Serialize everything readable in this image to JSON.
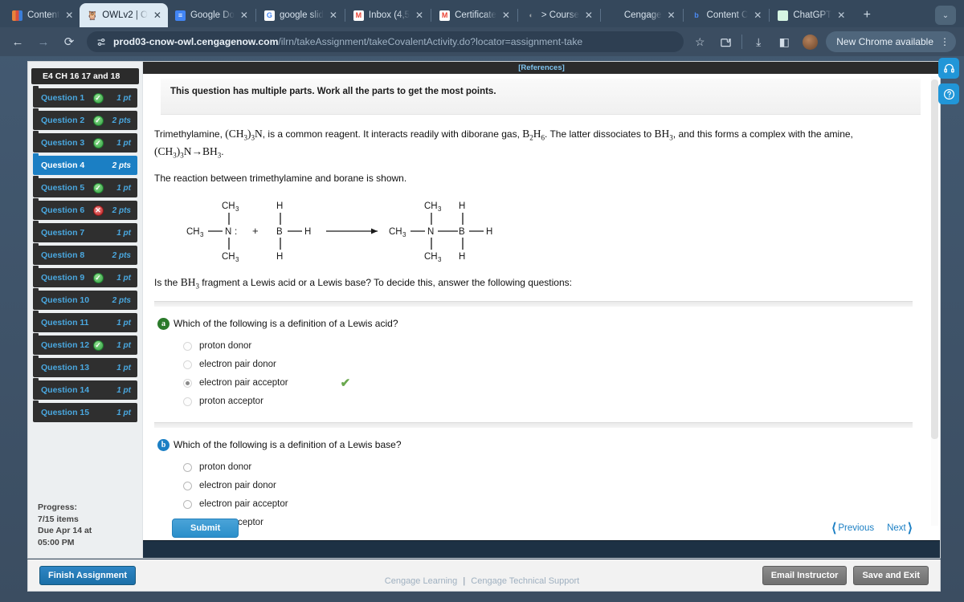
{
  "browser": {
    "tabs": [
      {
        "title": "Content",
        "favicon": "chart-bar-icon",
        "favicon_color": "#e8833a",
        "active": false
      },
      {
        "title": "OWLv2 | O",
        "favicon": "owl-icon",
        "favicon_color": "#8ec9ea",
        "active": true
      },
      {
        "title": "Google Do",
        "favicon": "google-docs-icon",
        "favicon_color": "#4285f4",
        "active": false
      },
      {
        "title": "google slid",
        "favicon": "google-icon",
        "favicon_color": "#ffffff",
        "active": false
      },
      {
        "title": "Inbox (4,5",
        "favicon": "gmail-icon",
        "favicon_color": "#ea4335",
        "active": false
      },
      {
        "title": "Certificate",
        "favicon": "gmail-icon",
        "favicon_color": "#ea4335",
        "active": false
      },
      {
        "title": "> Course ",
        "favicon": "moon-icon",
        "favicon_color": "#9aa0a6",
        "active": false
      },
      {
        "title": "Cengage ",
        "favicon": "blank-icon",
        "favicon_color": "#3b4d61",
        "active": false
      },
      {
        "title": "Content C",
        "favicon": "b-icon",
        "favicon_color": "#4c8bf5",
        "active": false
      },
      {
        "title": "ChatGPT",
        "favicon": "chatgpt-icon",
        "favicon_color": "#d6f5e3",
        "active": false
      }
    ],
    "new_tab_label": "+",
    "tab_list_label": "⌄",
    "back_label": "←",
    "forward_label": "→",
    "reload_label": "⟳",
    "url_prefix": "prod03-cnow-owl.cengagenow.com",
    "url_suffix": "/ilrn/takeAssignment/takeCovalentActivity.do?locator=assignment-take",
    "site_icon": "tune-icon",
    "bookmark_label": "☆",
    "extensions_label": "⬙",
    "download_label": "⤓",
    "sidepanel_label": "◧",
    "profile_label": "avatar",
    "update_label": "New Chrome available",
    "menu_label": "⋮"
  },
  "sidebar": {
    "assignment_title": "E4 CH 16 17 and 18",
    "questions": [
      {
        "label": "Question 1",
        "status": "correct",
        "points": "1 pt",
        "active": false
      },
      {
        "label": "Question 2",
        "status": "correct",
        "points": "2 pts",
        "active": false
      },
      {
        "label": "Question 3",
        "status": "correct",
        "points": "1 pt",
        "active": false
      },
      {
        "label": "Question 4",
        "status": "none",
        "points": "2 pts",
        "active": true
      },
      {
        "label": "Question 5",
        "status": "correct",
        "points": "1 pt",
        "active": false
      },
      {
        "label": "Question 6",
        "status": "incorrect",
        "points": "2 pts",
        "active": false
      },
      {
        "label": "Question 7",
        "status": "none",
        "points": "1 pt",
        "active": false
      },
      {
        "label": "Question 8",
        "status": "none",
        "points": "2 pts",
        "active": false
      },
      {
        "label": "Question 9",
        "status": "correct",
        "points": "1 pt",
        "active": false
      },
      {
        "label": "Question 10",
        "status": "none",
        "points": "2 pts",
        "active": false
      },
      {
        "label": "Question 11",
        "status": "none",
        "points": "1 pt",
        "active": false
      },
      {
        "label": "Question 12",
        "status": "correct",
        "points": "1 pt",
        "active": false
      },
      {
        "label": "Question 13",
        "status": "none",
        "points": "1 pt",
        "active": false
      },
      {
        "label": "Question 14",
        "status": "none",
        "points": "1 pt",
        "active": false
      },
      {
        "label": "Question 15",
        "status": "none",
        "points": "1 pt",
        "active": false
      }
    ],
    "progress_label": "Progress:",
    "progress_items": "7/15 items",
    "due_line1": "Due Apr 14 at",
    "due_line2": "05:00 PM"
  },
  "main": {
    "references_label": "[References]",
    "multipart_note": "This question has multiple parts. Work all the parts to get the most points.",
    "intro_paragraph_1": "Trimethylamine, (CH3)3N, is a common reagent. It interacts readily with diborane gas, B2H6. The latter dissociates to BH3, and this forms a complex with the amine, (CH3)3N→BH3.",
    "intro_paragraph_2": "The reaction between trimethylamine and borane is shown.",
    "question_prompt": "Is the BH3 fragment a Lewis acid or a Lewis base? To decide this, answer the following questions:",
    "reaction": {
      "reactant_amine": {
        "top": "CH3",
        "left": "CH3",
        "center": "N",
        "lone_pair": ":",
        "bottom": "CH3"
      },
      "plus": "+",
      "reactant_borane": {
        "top": "H",
        "center": "B",
        "right": "H",
        "bottom": "H"
      },
      "arrow": "→",
      "product": {
        "amine_top": "CH3",
        "amine_left": "CH3",
        "amine_center": "N",
        "amine_bottom": "CH3",
        "borane_top": "H",
        "borane_center": "B",
        "borane_right": "H",
        "borane_bottom": "H"
      }
    },
    "parts": [
      {
        "badge": "a",
        "badge_color": "#2b7a2b",
        "question": "Which of the following is a definition of a Lewis acid?",
        "options": [
          {
            "label": "proton donor",
            "selected": false
          },
          {
            "label": "electron pair donor",
            "selected": false
          },
          {
            "label": "electron pair acceptor",
            "selected": true
          },
          {
            "label": "proton acceptor",
            "selected": false
          }
        ],
        "answered": true,
        "tick": "✔"
      },
      {
        "badge": "b",
        "badge_color": "#1b7fc4",
        "question": "Which of the following is a definition of a Lewis base?",
        "options": [
          {
            "label": "proton donor",
            "selected": false
          },
          {
            "label": "electron pair donor",
            "selected": false
          },
          {
            "label": "electron pair acceptor",
            "selected": false
          },
          {
            "label": "proton acceptor",
            "selected": false
          }
        ],
        "answered": false,
        "tick": ""
      }
    ],
    "submit_label": "Submit",
    "previous_label": "Previous",
    "next_label": "Next"
  },
  "footer": {
    "finish_label": "Finish Assignment",
    "email_instructor_label": "Email Instructor",
    "save_exit_label": "Save and Exit",
    "cengage_learning": "Cengage Learning",
    "cengage_support": "Cengage Technical Support"
  },
  "helpers": {
    "support_icon": "headset-icon",
    "help_icon": "question-mark-icon"
  },
  "colors": {
    "accent_blue": "#1b7fc4",
    "link_blue": "#4aa8e0",
    "correct_green": "#2f9e3f",
    "incorrect_red": "#c32222",
    "tick_green": "#6aa84f"
  }
}
